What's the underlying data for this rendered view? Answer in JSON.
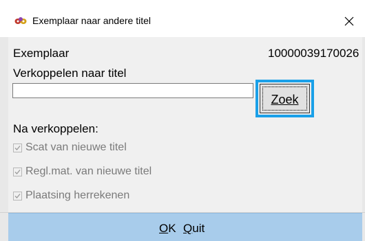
{
  "window": {
    "title": "Exemplaar naar andere titel",
    "icon": "koha-app-icon",
    "close_icon": "close-icon"
  },
  "form": {
    "exemplaar_label": "Exemplaar",
    "exemplaar_value": "10000039170026",
    "verkoppelen_label": "Verkoppelen naar titel",
    "title_input_value": "",
    "title_input_placeholder": "",
    "search_button_label": "Zoek",
    "na_verkoppelen_label": "Na verkoppelen:",
    "options": [
      {
        "label": "Scat van nieuwe titel",
        "checked": true
      },
      {
        "label": "Regl.mat. van nieuwe titel",
        "checked": true
      },
      {
        "label": "Plaatsing herrekenen",
        "checked": true
      }
    ]
  },
  "footer": {
    "ok_mnemonic": "O",
    "ok_rest": "K",
    "quit_mnemonic": "Q",
    "quit_rest": "uit",
    "background_color": "#a8cceb"
  },
  "colors": {
    "highlight_border": "#1aa0e8",
    "disabled_text": "#7a7a7a"
  }
}
